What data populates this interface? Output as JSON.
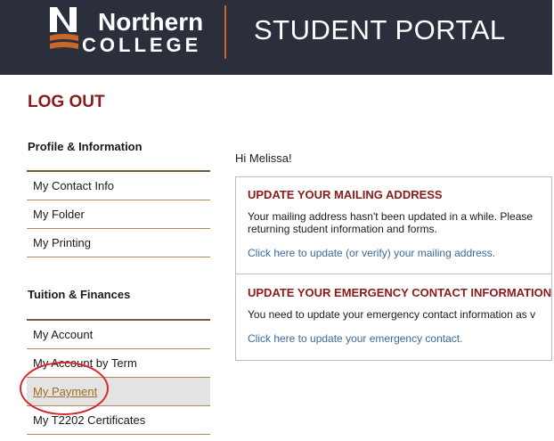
{
  "header": {
    "logo_letter": "N",
    "logo_line1": "Northern",
    "logo_line2": "COLLEGE",
    "portal_title": "STUDENT PORTAL"
  },
  "logout_label": "LOG OUT",
  "sidebar": {
    "sections": [
      {
        "heading": "Profile & Information",
        "items": [
          {
            "label": "My Contact Info"
          },
          {
            "label": "My Folder"
          },
          {
            "label": "My Printing"
          }
        ]
      },
      {
        "heading": "Tuition & Finances",
        "items": [
          {
            "label": "My Account"
          },
          {
            "label": "My Account by Term"
          },
          {
            "label": "My Payment"
          },
          {
            "label": "My T2202 Certificates"
          }
        ]
      }
    ]
  },
  "main": {
    "greeting": "Hi Melissa!",
    "notices": [
      {
        "title": "UPDATE YOUR MAILING ADDRESS",
        "body_line1": "Your mailing address hasn't been updated in a while. Please",
        "body_line2": "returning student information and forms.",
        "link": "Click here to update (or verify) your mailing address."
      },
      {
        "title": "UPDATE YOUR EMERGENCY CONTACT INFORMATION",
        "body_line1": "You need to update your emergency contact information as v",
        "link": "Click here to update your emergency contact."
      }
    ]
  },
  "colors": {
    "header_bg": "#2b2f3b",
    "accent_orange": "#c8672a",
    "heading_red": "#8b1a1a",
    "link_blue": "#3a6a9a",
    "annotation_circle": "#d42a2a"
  }
}
